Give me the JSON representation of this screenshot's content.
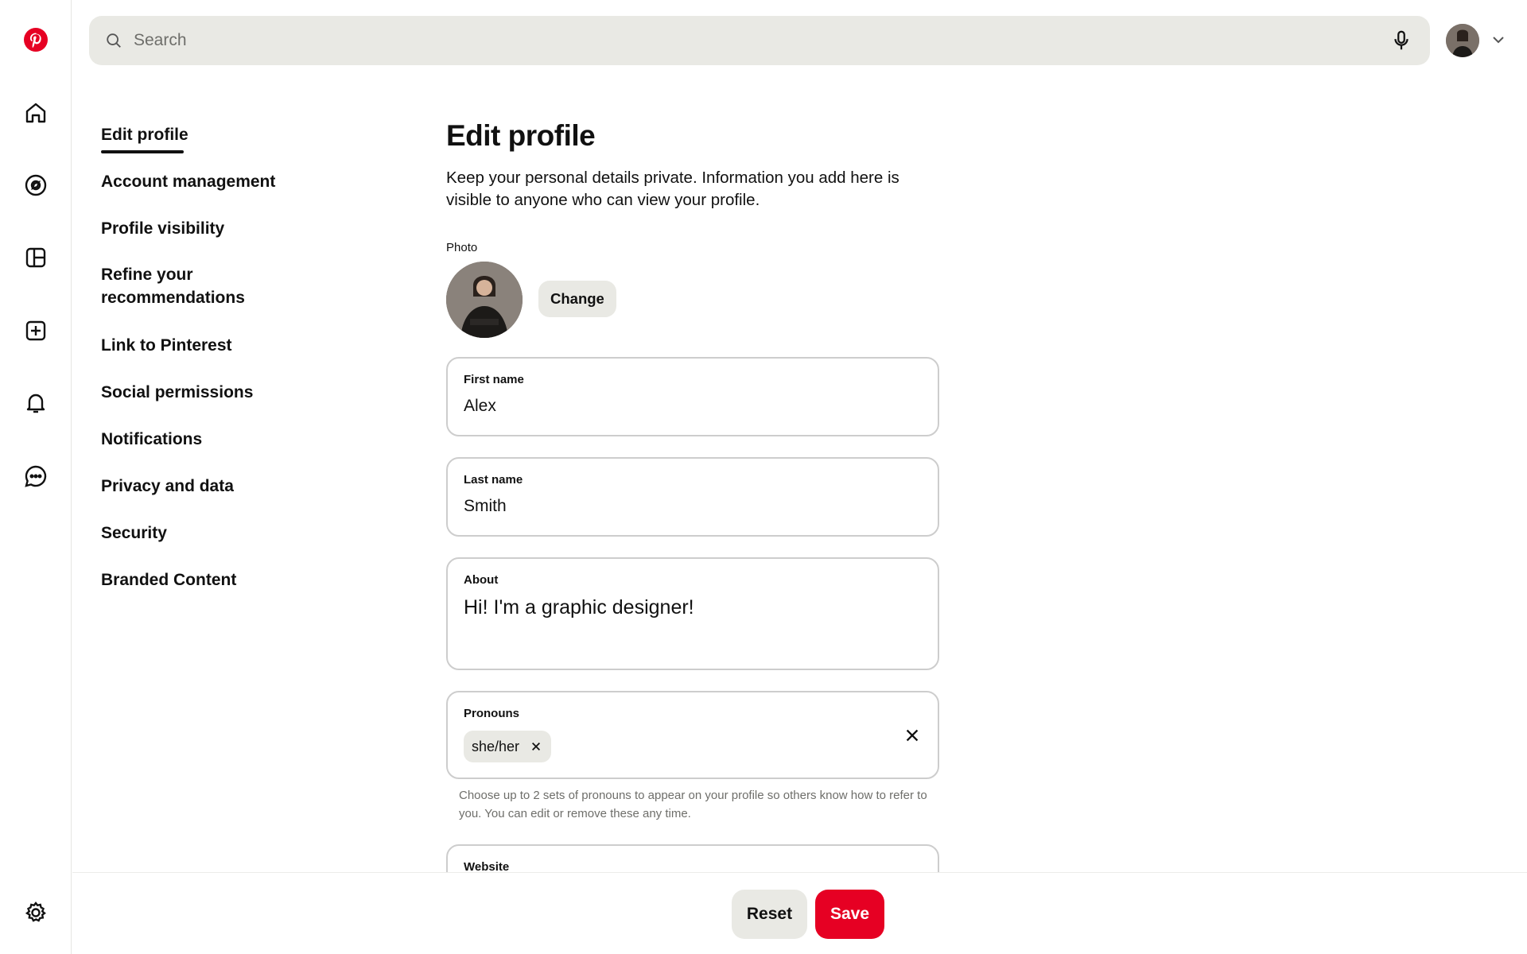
{
  "colors": {
    "brand": "#e60023",
    "surface": "#e9e9e4",
    "text": "#111111",
    "muted": "#6e6e6a",
    "border": "#cdcdcd"
  },
  "rail": {
    "items": [
      {
        "icon": "pinterest-logo-icon"
      },
      {
        "icon": "home-icon"
      },
      {
        "icon": "explore-compass-icon"
      },
      {
        "icon": "boards-layout-icon"
      },
      {
        "icon": "create-plus-icon"
      },
      {
        "icon": "notifications-bell-icon"
      },
      {
        "icon": "messages-chat-icon"
      },
      {
        "icon": "settings-gear-icon"
      }
    ]
  },
  "search": {
    "placeholder": "Search",
    "value": ""
  },
  "settings_nav": {
    "items": [
      {
        "label": "Edit profile",
        "active": true
      },
      {
        "label": "Account management"
      },
      {
        "label": "Profile visibility"
      },
      {
        "label": "Refine your recommendations"
      },
      {
        "label": "Link to Pinterest"
      },
      {
        "label": "Social permissions"
      },
      {
        "label": "Notifications"
      },
      {
        "label": "Privacy and data"
      },
      {
        "label": "Security"
      },
      {
        "label": "Branded Content"
      }
    ]
  },
  "main": {
    "title": "Edit profile",
    "description": "Keep your personal details private. Information you add here is visible to anyone who can view your profile.",
    "photo_label": "Photo",
    "change_label": "Change",
    "first_name": {
      "label": "First name",
      "value": "Alex"
    },
    "last_name": {
      "label": "Last name",
      "value": "Smith"
    },
    "about": {
      "label": "About",
      "value": "Hi! I'm a graphic designer!"
    },
    "pronouns": {
      "label": "Pronouns",
      "chips": [
        "she/her"
      ]
    },
    "pronouns_helper": "Choose up to 2 sets of pronouns to appear on your profile so others know how to refer to you. You can edit or remove these any time.",
    "website": {
      "label": "Website"
    }
  },
  "footer": {
    "reset_label": "Reset",
    "save_label": "Save"
  }
}
